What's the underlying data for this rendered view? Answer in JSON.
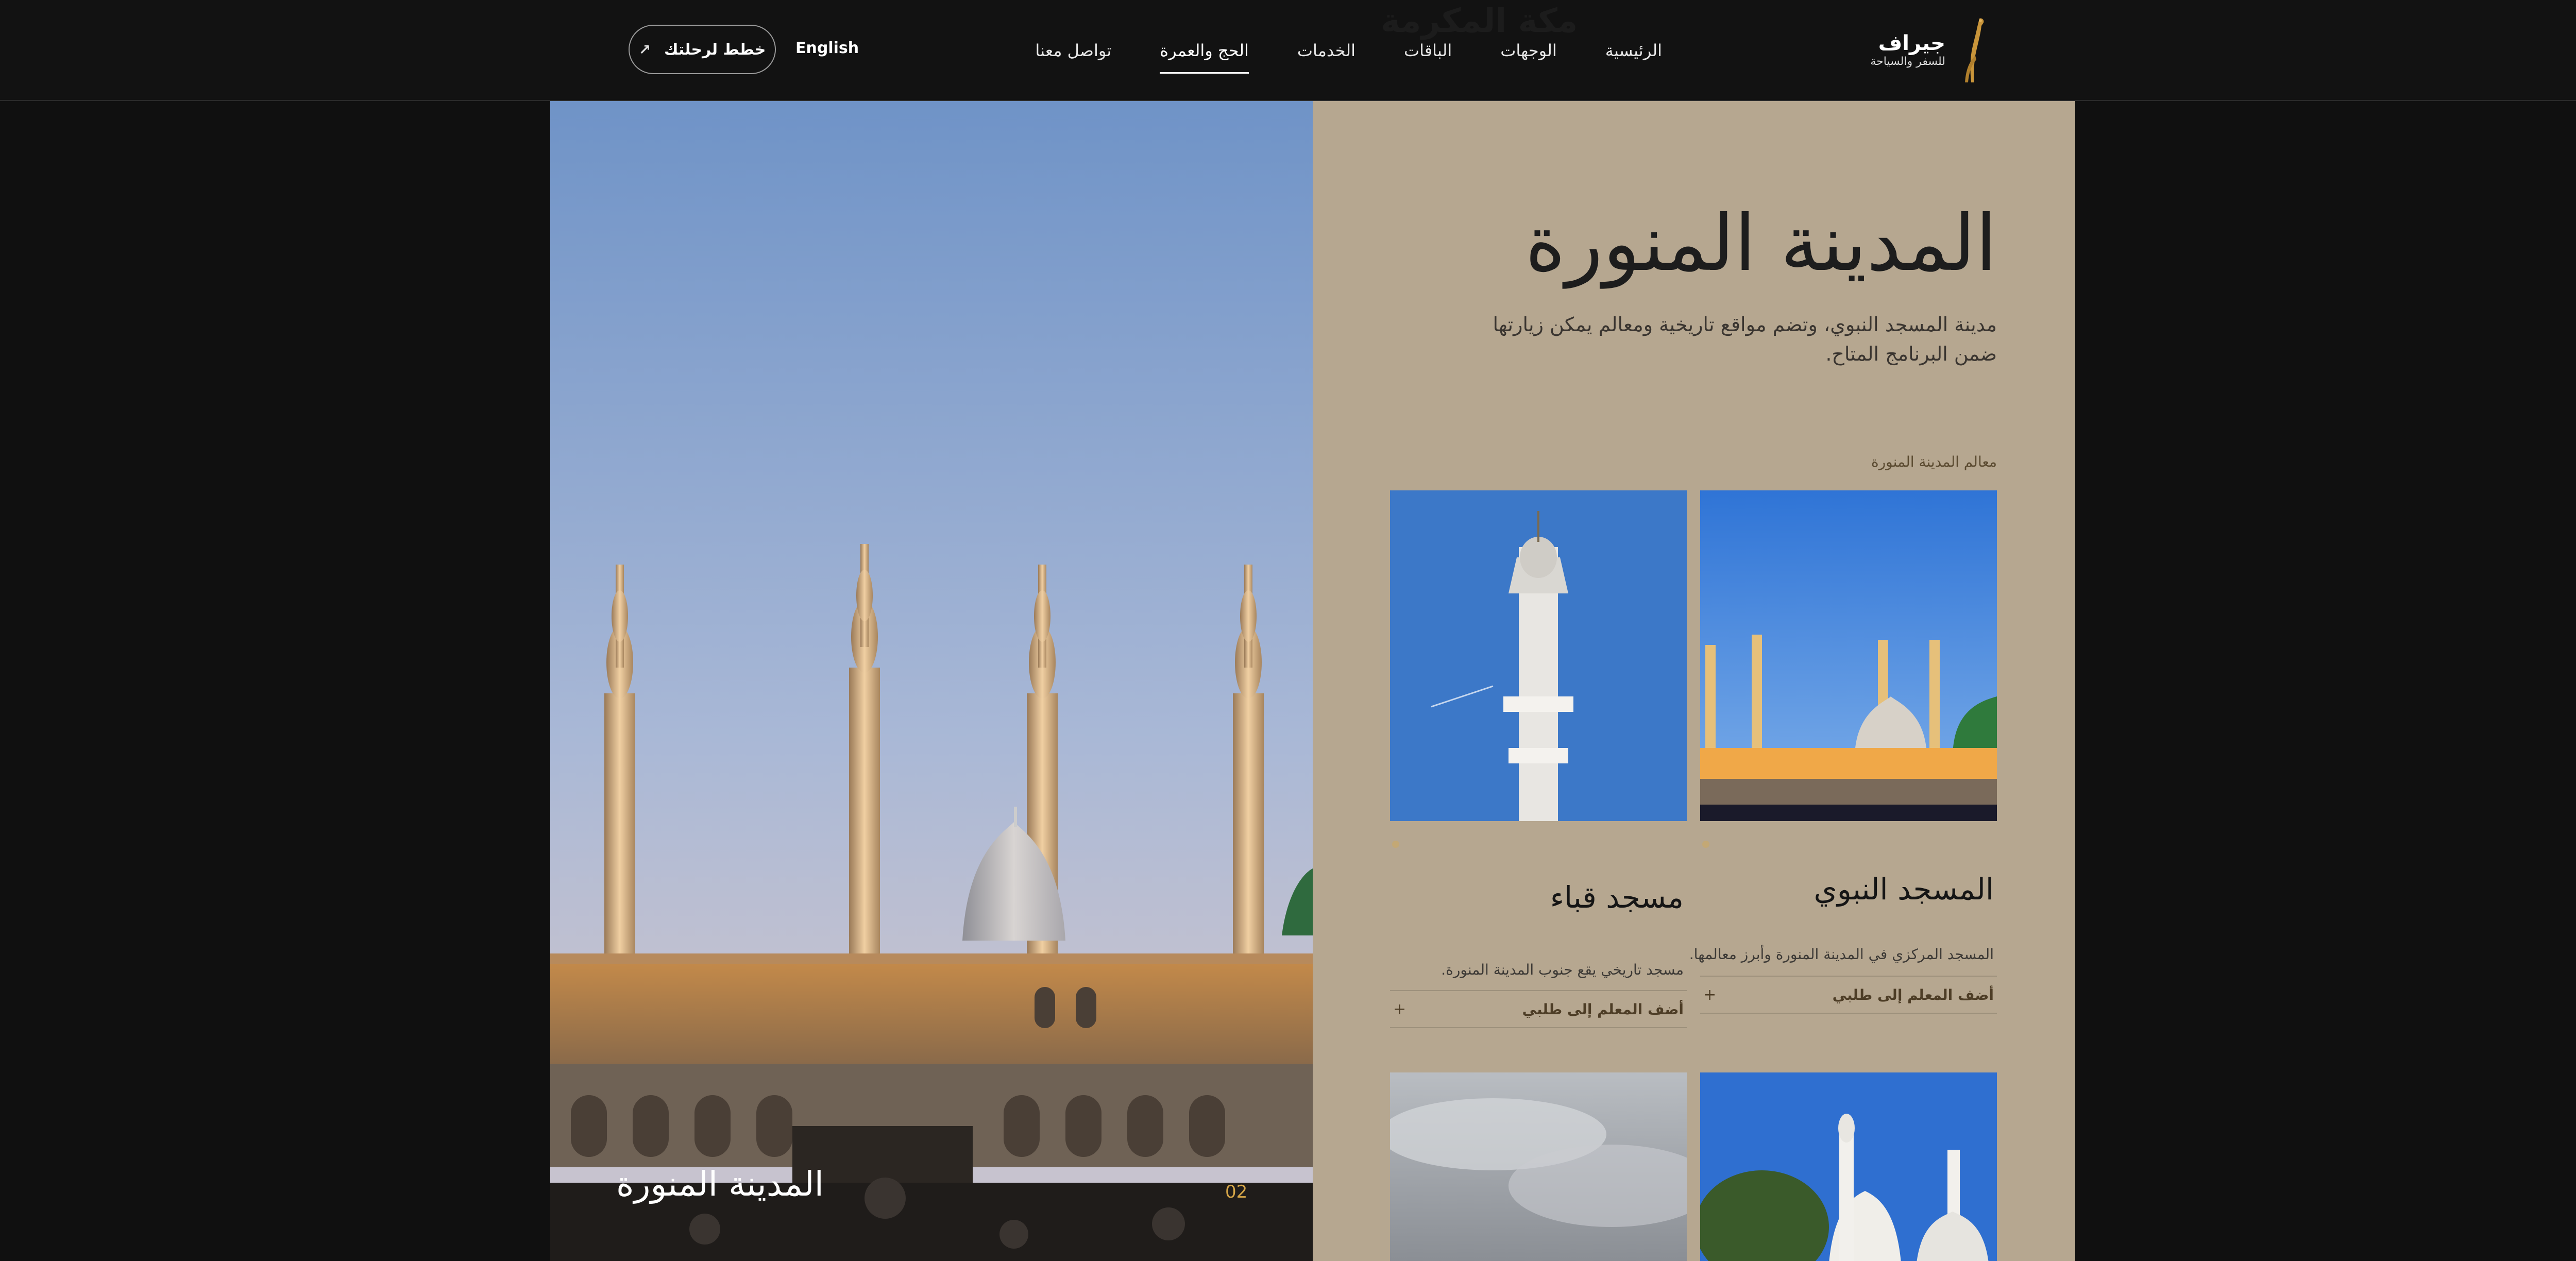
{
  "header": {
    "ghost_text": "مكة المكرمة",
    "logo_title": "جيراف",
    "logo_subtitle": "للسفر والسياحة",
    "nav": [
      {
        "label": "الرئيسية"
      },
      {
        "label": "الوجهات"
      },
      {
        "label": "الباقات"
      },
      {
        "label": "الخدمات"
      },
      {
        "label": "الحج والعمرة"
      },
      {
        "label": "تواصل معنا"
      }
    ],
    "active_nav": "الحج والعمرة",
    "language": "English",
    "plan_button": "خطط لرحلتك",
    "plan_icon": "↗"
  },
  "hero": {
    "caption": "المدينة المنورة",
    "index": "02"
  },
  "panel": {
    "title": "المدينة المنورة",
    "description": "مدينة المسجد النبوي، وتضم مواقع تاريخية ومعالم يمكن زيارتها ضمن البرنامج المتاح.",
    "section_label": "معالم المدينة المنورة",
    "cards": [
      {
        "title": "المسجد النبوي",
        "description": "المسجد المركزي في المدينة المنورة وأبرز معالمها.",
        "add_label": "أضف المعلم إلى طلبي",
        "add_icon": "+"
      },
      {
        "title": "مسجد قباء",
        "description": "مسجد تاريخي يقع جنوب المدينة المنورة.",
        "add_label": "أضف المعلم إلى طلبي",
        "add_icon": "+"
      }
    ]
  },
  "colors": {
    "background": "#101010",
    "panel": "#b6a790",
    "accent": "#d6a648"
  }
}
